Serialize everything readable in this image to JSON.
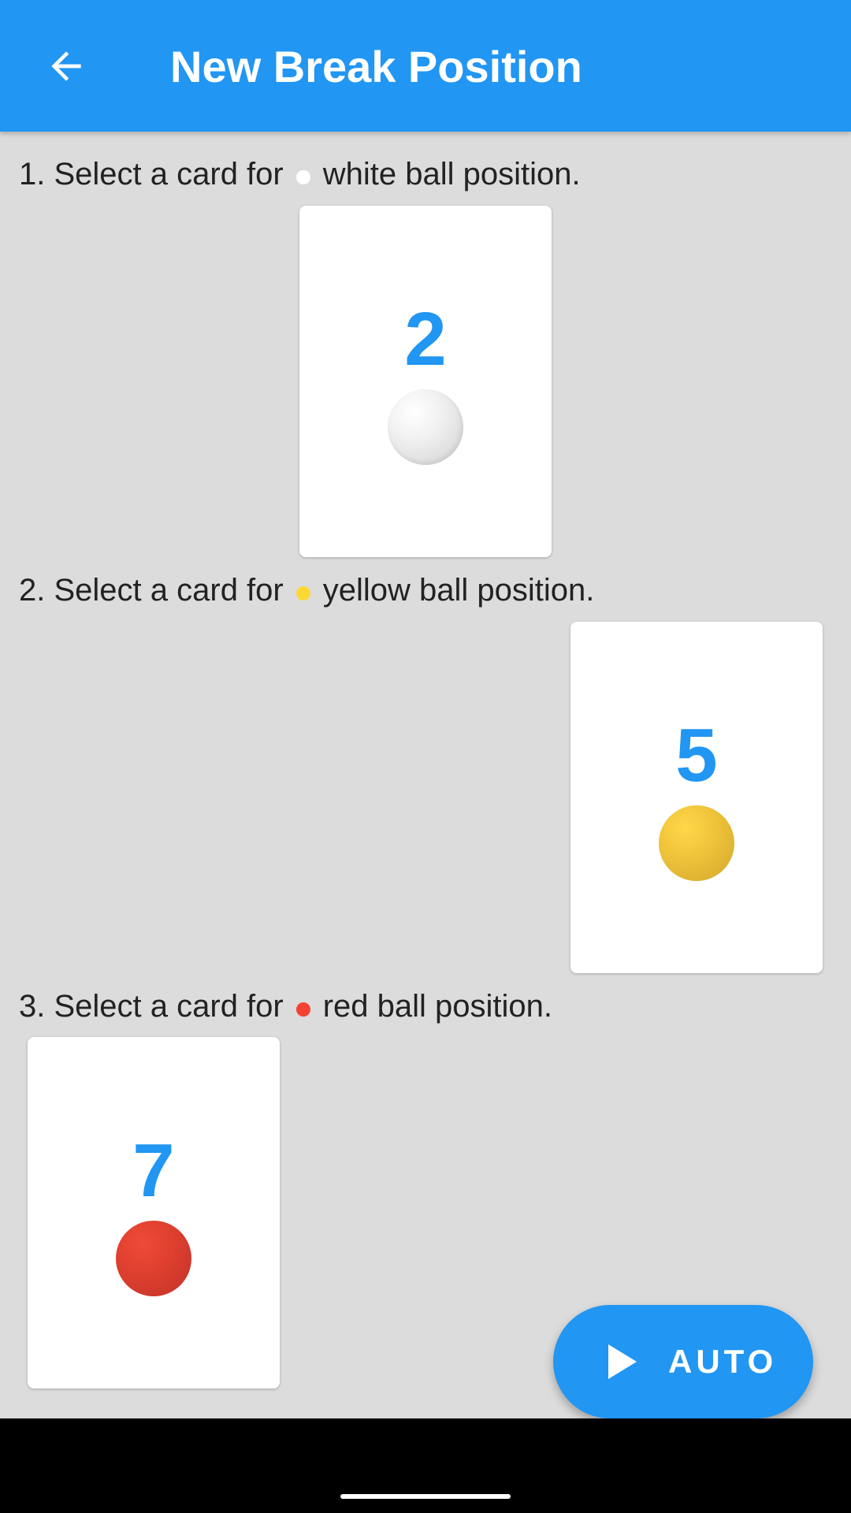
{
  "app_bar": {
    "title": "New Break Position",
    "back_icon": "arrow-left-icon",
    "color": "#2196f3"
  },
  "steps": [
    {
      "number": "1.",
      "text_before": "Select a card for",
      "text_after": "white ball position.",
      "dot_color": "#ffffff",
      "card": {
        "number": "2",
        "ball": "white"
      }
    },
    {
      "number": "2.",
      "text_before": "Select a card for",
      "text_after": "yellow ball position.",
      "dot_color": "#fdd835",
      "card": {
        "number": "5",
        "ball": "yellow"
      }
    },
    {
      "number": "3.",
      "text_before": "Select a card for",
      "text_after": "red ball position.",
      "dot_color": "#f44336",
      "card": {
        "number": "7",
        "ball": "red"
      }
    }
  ],
  "fab": {
    "label": "AUTO",
    "icon": "play-icon"
  },
  "colors": {
    "accent": "#2196f3",
    "background": "#dcdcdc"
  }
}
